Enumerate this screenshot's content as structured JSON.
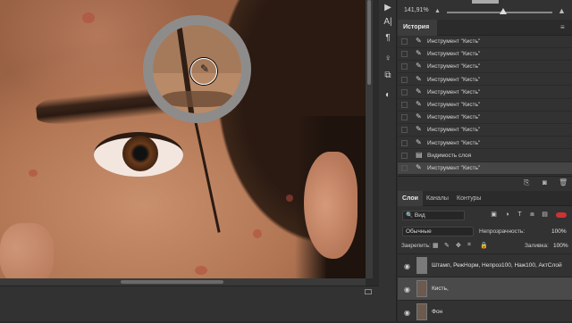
{
  "navigator": {
    "zoom_value": "141,91%"
  },
  "history": {
    "tab_label": "История",
    "menu_icon": "menu-icon",
    "rows": [
      {
        "label": "Инструмент \"Кисть\"",
        "icon": "brush-icon",
        "active": false
      },
      {
        "label": "Инструмент \"Кисть\"",
        "icon": "brush-icon",
        "active": false
      },
      {
        "label": "Инструмент \"Кисть\"",
        "icon": "brush-icon",
        "active": false
      },
      {
        "label": "Инструмент \"Кисть\"",
        "icon": "brush-icon",
        "active": false
      },
      {
        "label": "Инструмент \"Кисть\"",
        "icon": "brush-icon",
        "active": false
      },
      {
        "label": "Инструмент \"Кисть\"",
        "icon": "brush-icon",
        "active": false
      },
      {
        "label": "Инструмент \"Кисть\"",
        "icon": "brush-icon",
        "active": false
      },
      {
        "label": "Инструмент \"Кисть\"",
        "icon": "brush-icon",
        "active": false
      },
      {
        "label": "Инструмент \"Кисть\"",
        "icon": "brush-icon",
        "active": false
      },
      {
        "label": "Видимость слоя",
        "icon": "layer-visibility-icon",
        "active": false
      },
      {
        "label": "Инструмент \"Кисть\"",
        "icon": "brush-icon",
        "active": true
      }
    ]
  },
  "layers_panel": {
    "tabs": [
      "Слои",
      "Каналы",
      "Контуры"
    ],
    "active_tab": "Слои",
    "filter_label": "Вид",
    "blend_mode": "Обычные",
    "opacity_label": "Непрозрачность:",
    "opacity_value": "100%",
    "lock_label": "Закрепить:",
    "fill_label": "Заливка:",
    "fill_value": "100%",
    "layers": [
      {
        "name": "Штамп, РежНорм, Непроз100, Наж100, АктСлой",
        "selected": false,
        "thumb_color": "#7a7a7a"
      },
      {
        "name": "Кисть,",
        "selected": true,
        "thumb_color": "#6b5a4d"
      },
      {
        "name": "Фон",
        "selected": false,
        "thumb_color": "#6b5a4d"
      }
    ]
  },
  "colors": {
    "panel_bg": "#323232",
    "selected_layer": "#4a4a4a",
    "active_history": "#454545",
    "filter_toggle": "#cc3333"
  }
}
